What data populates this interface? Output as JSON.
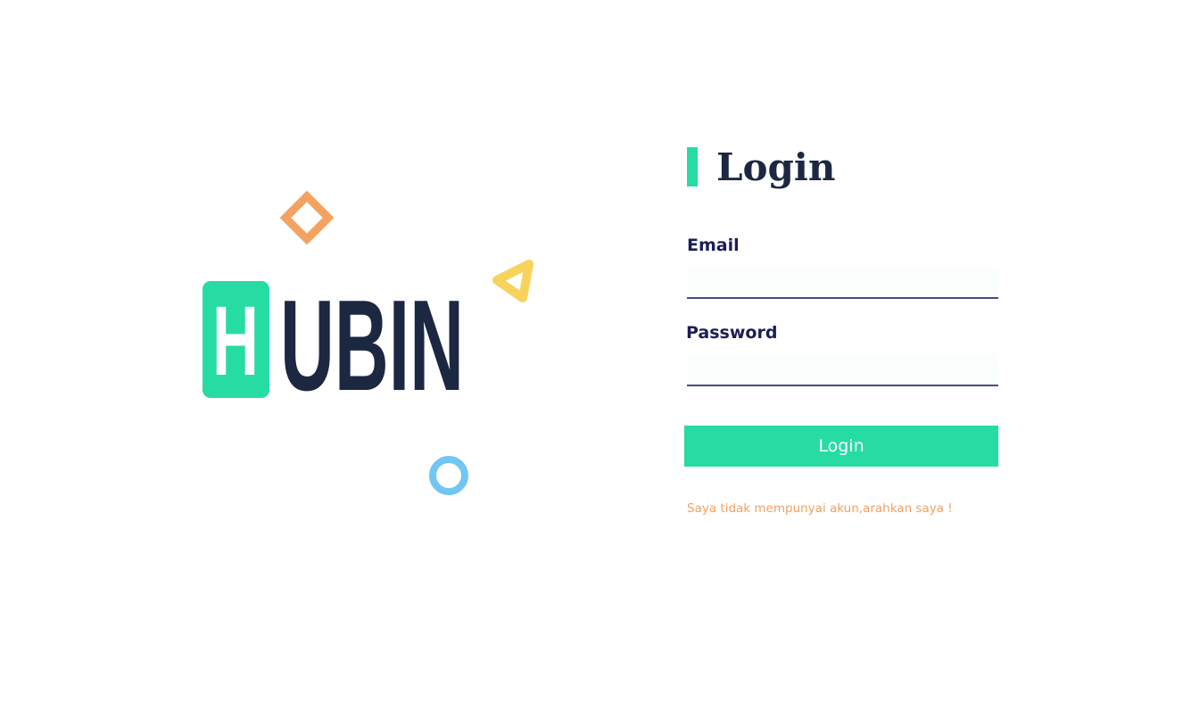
{
  "logo": {
    "letter_h": "H",
    "rest": "UBIN",
    "colors": {
      "green": "#27dca3",
      "navy": "#1c2742",
      "orange": "#f5a261",
      "yellow": "#f7d35c",
      "blue": "#71c6f3"
    }
  },
  "login": {
    "title": "Login",
    "email_label": "Email",
    "email_value": "",
    "password_label": "Password",
    "password_value": "",
    "button_label": "Login",
    "register_link": "Saya tidak mempunyai akun,arahkan saya !"
  },
  "colors": {
    "accent": "#27dca3",
    "title": "#1c2742",
    "label": "#1b1d57",
    "link": "#f0a063"
  }
}
